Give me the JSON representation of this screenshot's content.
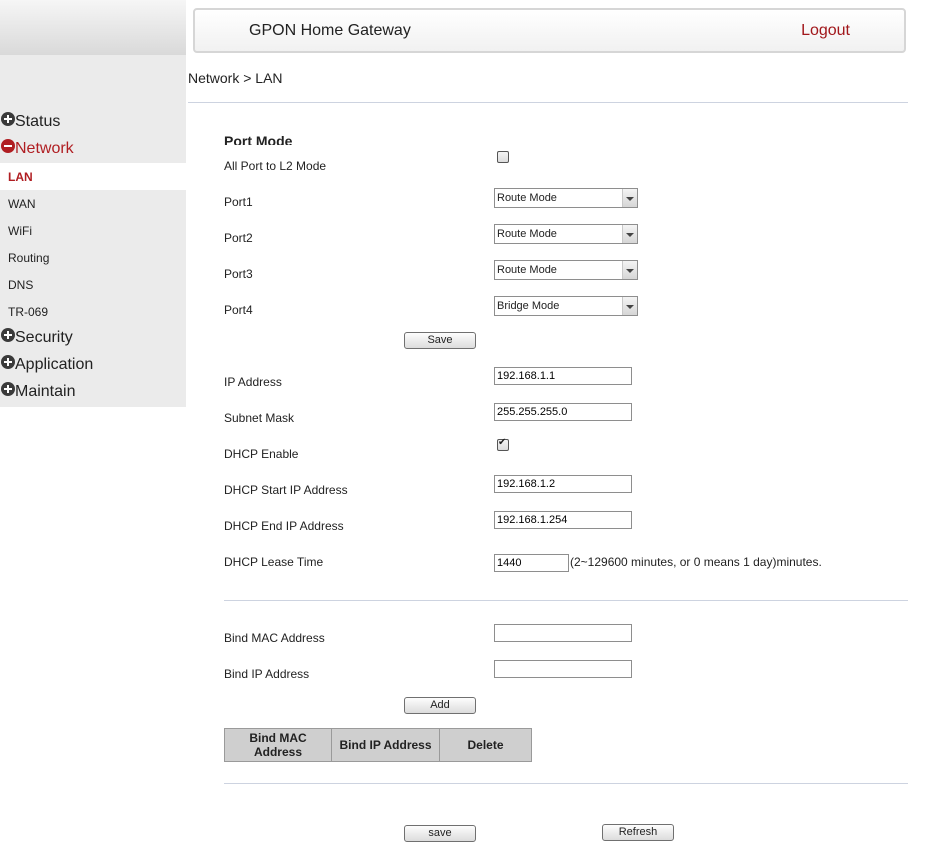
{
  "header": {
    "title": "GPON Home Gateway",
    "logout": "Logout"
  },
  "breadcrumb": "Network > LAN",
  "sidebar": {
    "groups": [
      {
        "label": "Status",
        "state": "collapsed"
      },
      {
        "label": "Network",
        "state": "expanded",
        "sub_items": [
          "LAN",
          "WAN",
          "WiFi",
          "Routing",
          "DNS",
          "TR-069"
        ],
        "active_sub_item": "LAN"
      },
      {
        "label": "Security",
        "state": "collapsed"
      },
      {
        "label": "Application",
        "state": "collapsed"
      },
      {
        "label": "Maintain",
        "state": "collapsed"
      }
    ]
  },
  "port_mode": {
    "title": "Port Mode",
    "all_port_l2_label": "All Port to L2 Mode",
    "all_port_l2_checked": false,
    "ports": [
      {
        "label": "Port1",
        "value": "Route  Mode"
      },
      {
        "label": "Port2",
        "value": "Route  Mode"
      },
      {
        "label": "Port3",
        "value": "Route  Mode"
      },
      {
        "label": "Port4",
        "value": "Bridge  Mode"
      }
    ],
    "save_label": "Save"
  },
  "lan": {
    "ip_address_label": "IP Address",
    "ip_address": "192.168.1.1",
    "subnet_mask_label": "Subnet Mask",
    "subnet_mask": "255.255.255.0",
    "dhcp_enable_label": "DHCP Enable",
    "dhcp_enabled": true,
    "dhcp_start_label": "DHCP Start IP Address",
    "dhcp_start": "192.168.1.2",
    "dhcp_end_label": "DHCP End IP Address",
    "dhcp_end": "192.168.1.254",
    "lease_label": "DHCP Lease Time",
    "lease_value": "1440",
    "lease_hint": "(2~129600 minutes, or 0 means 1 day)minutes."
  },
  "binding": {
    "mac_label": "Bind MAC Address",
    "mac_value": "",
    "ip_label": "Bind IP Address",
    "ip_value": "",
    "add_label": "Add",
    "table_headers": [
      "Bind MAC Address",
      "Bind IP Address",
      "Delete"
    ]
  },
  "footer": {
    "save_label": "save",
    "refresh_label": "Refresh"
  }
}
